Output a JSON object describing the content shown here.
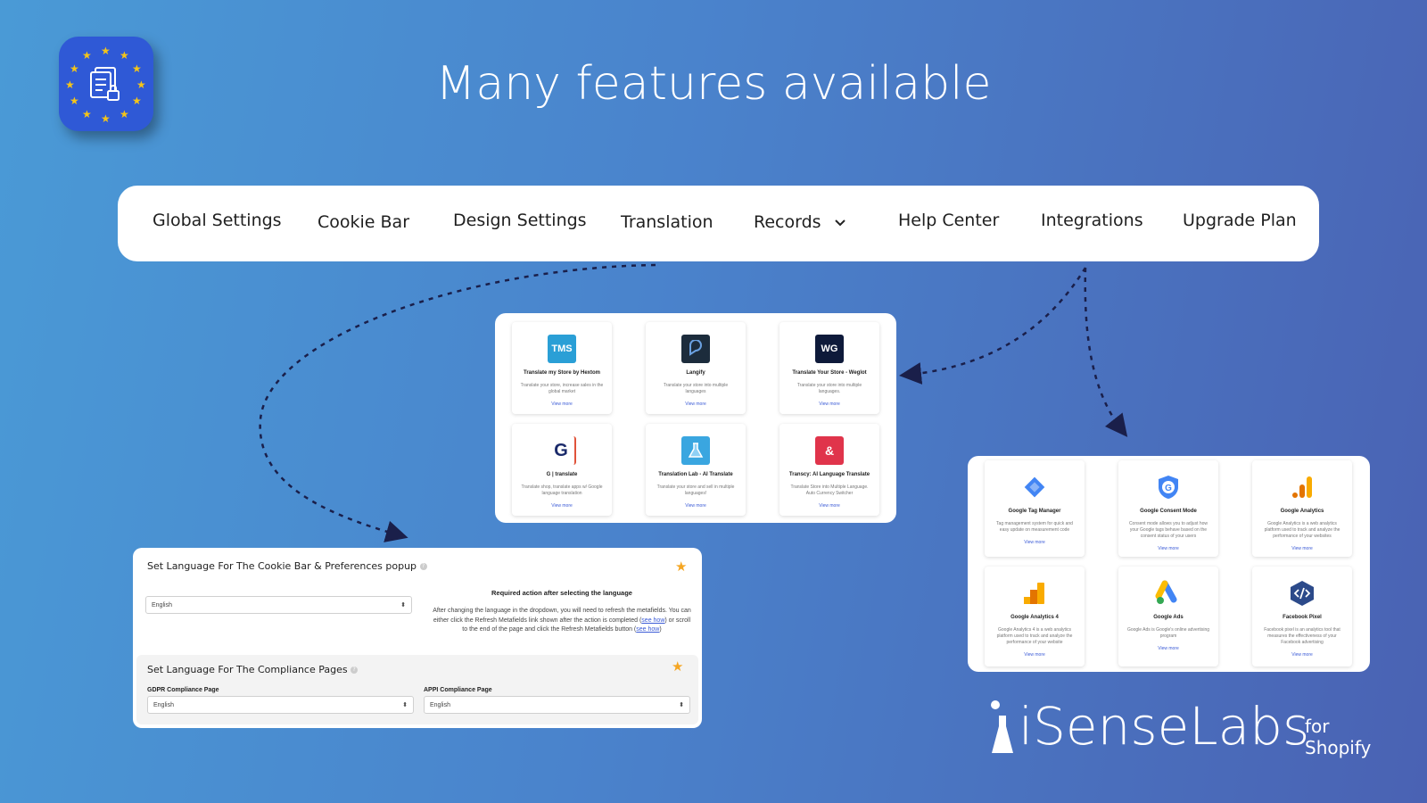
{
  "hero": {
    "title": "Many features available"
  },
  "navbar": {
    "items": [
      {
        "label": "Global Settings"
      },
      {
        "label": "Cookie Bar"
      },
      {
        "label": "Design Settings"
      },
      {
        "label": "Translation"
      },
      {
        "label": "Records"
      },
      {
        "label": "Help Center"
      },
      {
        "label": "Integrations"
      },
      {
        "label": "Upgrade Plan"
      }
    ]
  },
  "translation_apps": [
    {
      "logo_text": "TMS",
      "logo_color": "#2a9fd6",
      "title": "Translate my Store by Hextom",
      "desc": "Translate your store, increase sales in the global market",
      "more": "View more"
    },
    {
      "logo_text": "",
      "logo_color": "#1c2c3c",
      "title": "Langify",
      "desc": "Translate your store into multiple languages",
      "more": "View more"
    },
    {
      "logo_text": "WG",
      "logo_color": "#0e1a3a",
      "title": "Translate Your Store - Weglot",
      "desc": "Translate your store into multiple languages.",
      "more": "View more"
    },
    {
      "logo_text": "G",
      "logo_color": "#ffffff",
      "title": "G | translate",
      "desc": "Translate shop, translate apps w/ Google language translation",
      "more": "View more"
    },
    {
      "logo_text": "",
      "logo_color": "#3aa6e0",
      "title": "Translation Lab - AI Translate",
      "desc": "Translate your store and sell in multiple languages!",
      "more": "View more"
    },
    {
      "logo_text": "",
      "logo_color": "#e0344b",
      "title": "Transcy: AI Language Translate",
      "desc": "Translate Store into Multiple Language. Auto Currency Switcher",
      "more": "View more"
    }
  ],
  "integration_apps": [
    {
      "title": "Google Tag Manager",
      "desc": "Tag management system for quick and easy update on measurement code",
      "more": "View more"
    },
    {
      "title": "Google Consent Mode",
      "desc": "Consent mode allows you to adjust how your Google tags behave based on the consent status of your users",
      "more": "View more"
    },
    {
      "title": "Google Analytics",
      "desc": "Google Analytics is a web analytics platform used to track and analyze the performance of your websites",
      "more": "View more"
    },
    {
      "title": "Google Analytics 4",
      "desc": "Google Analytics 4 is a web analytics platform used to track and analyze the performance of your website",
      "more": "View more"
    },
    {
      "title": "Google Ads",
      "desc": "Google Ads is Google's online advertising program",
      "more": "View more"
    },
    {
      "title": "Facebook Pixel",
      "desc": "Facebook pixel is an analytics tool that measures the effectiveness of your Facebook advertising",
      "more": "View more"
    }
  ],
  "language_settings": {
    "cookie_bar_title": "Set Language For The Cookie Bar & Preferences popup",
    "cookie_bar_value": "English",
    "required_title": "Required action after selecting the language",
    "required_body_1": "After changing the language in the dropdown, you will need to refresh the metafields. You can either click the Refresh Metafields link shown after the action is completed (",
    "see_how_1": "see how",
    "required_body_2": ") or scroll to the end of the page and click the Refresh Metafields button (",
    "see_how_2": "see how",
    "required_body_3": ")",
    "compliance_title": "Set Language For The Compliance Pages",
    "gdpr_label": "GDPR Compliance Page",
    "gdpr_value": "English",
    "appi_label": "APPI Compliance Page",
    "appi_value": "English"
  },
  "brand": {
    "name": "iSenseLabs",
    "for_line1": "for",
    "for_line2": "Shopify"
  },
  "colors": {
    "background_start": "#4a9ad6",
    "background_end": "#4a62b3",
    "link": "#3b5bd6",
    "star": "#f5a623"
  }
}
